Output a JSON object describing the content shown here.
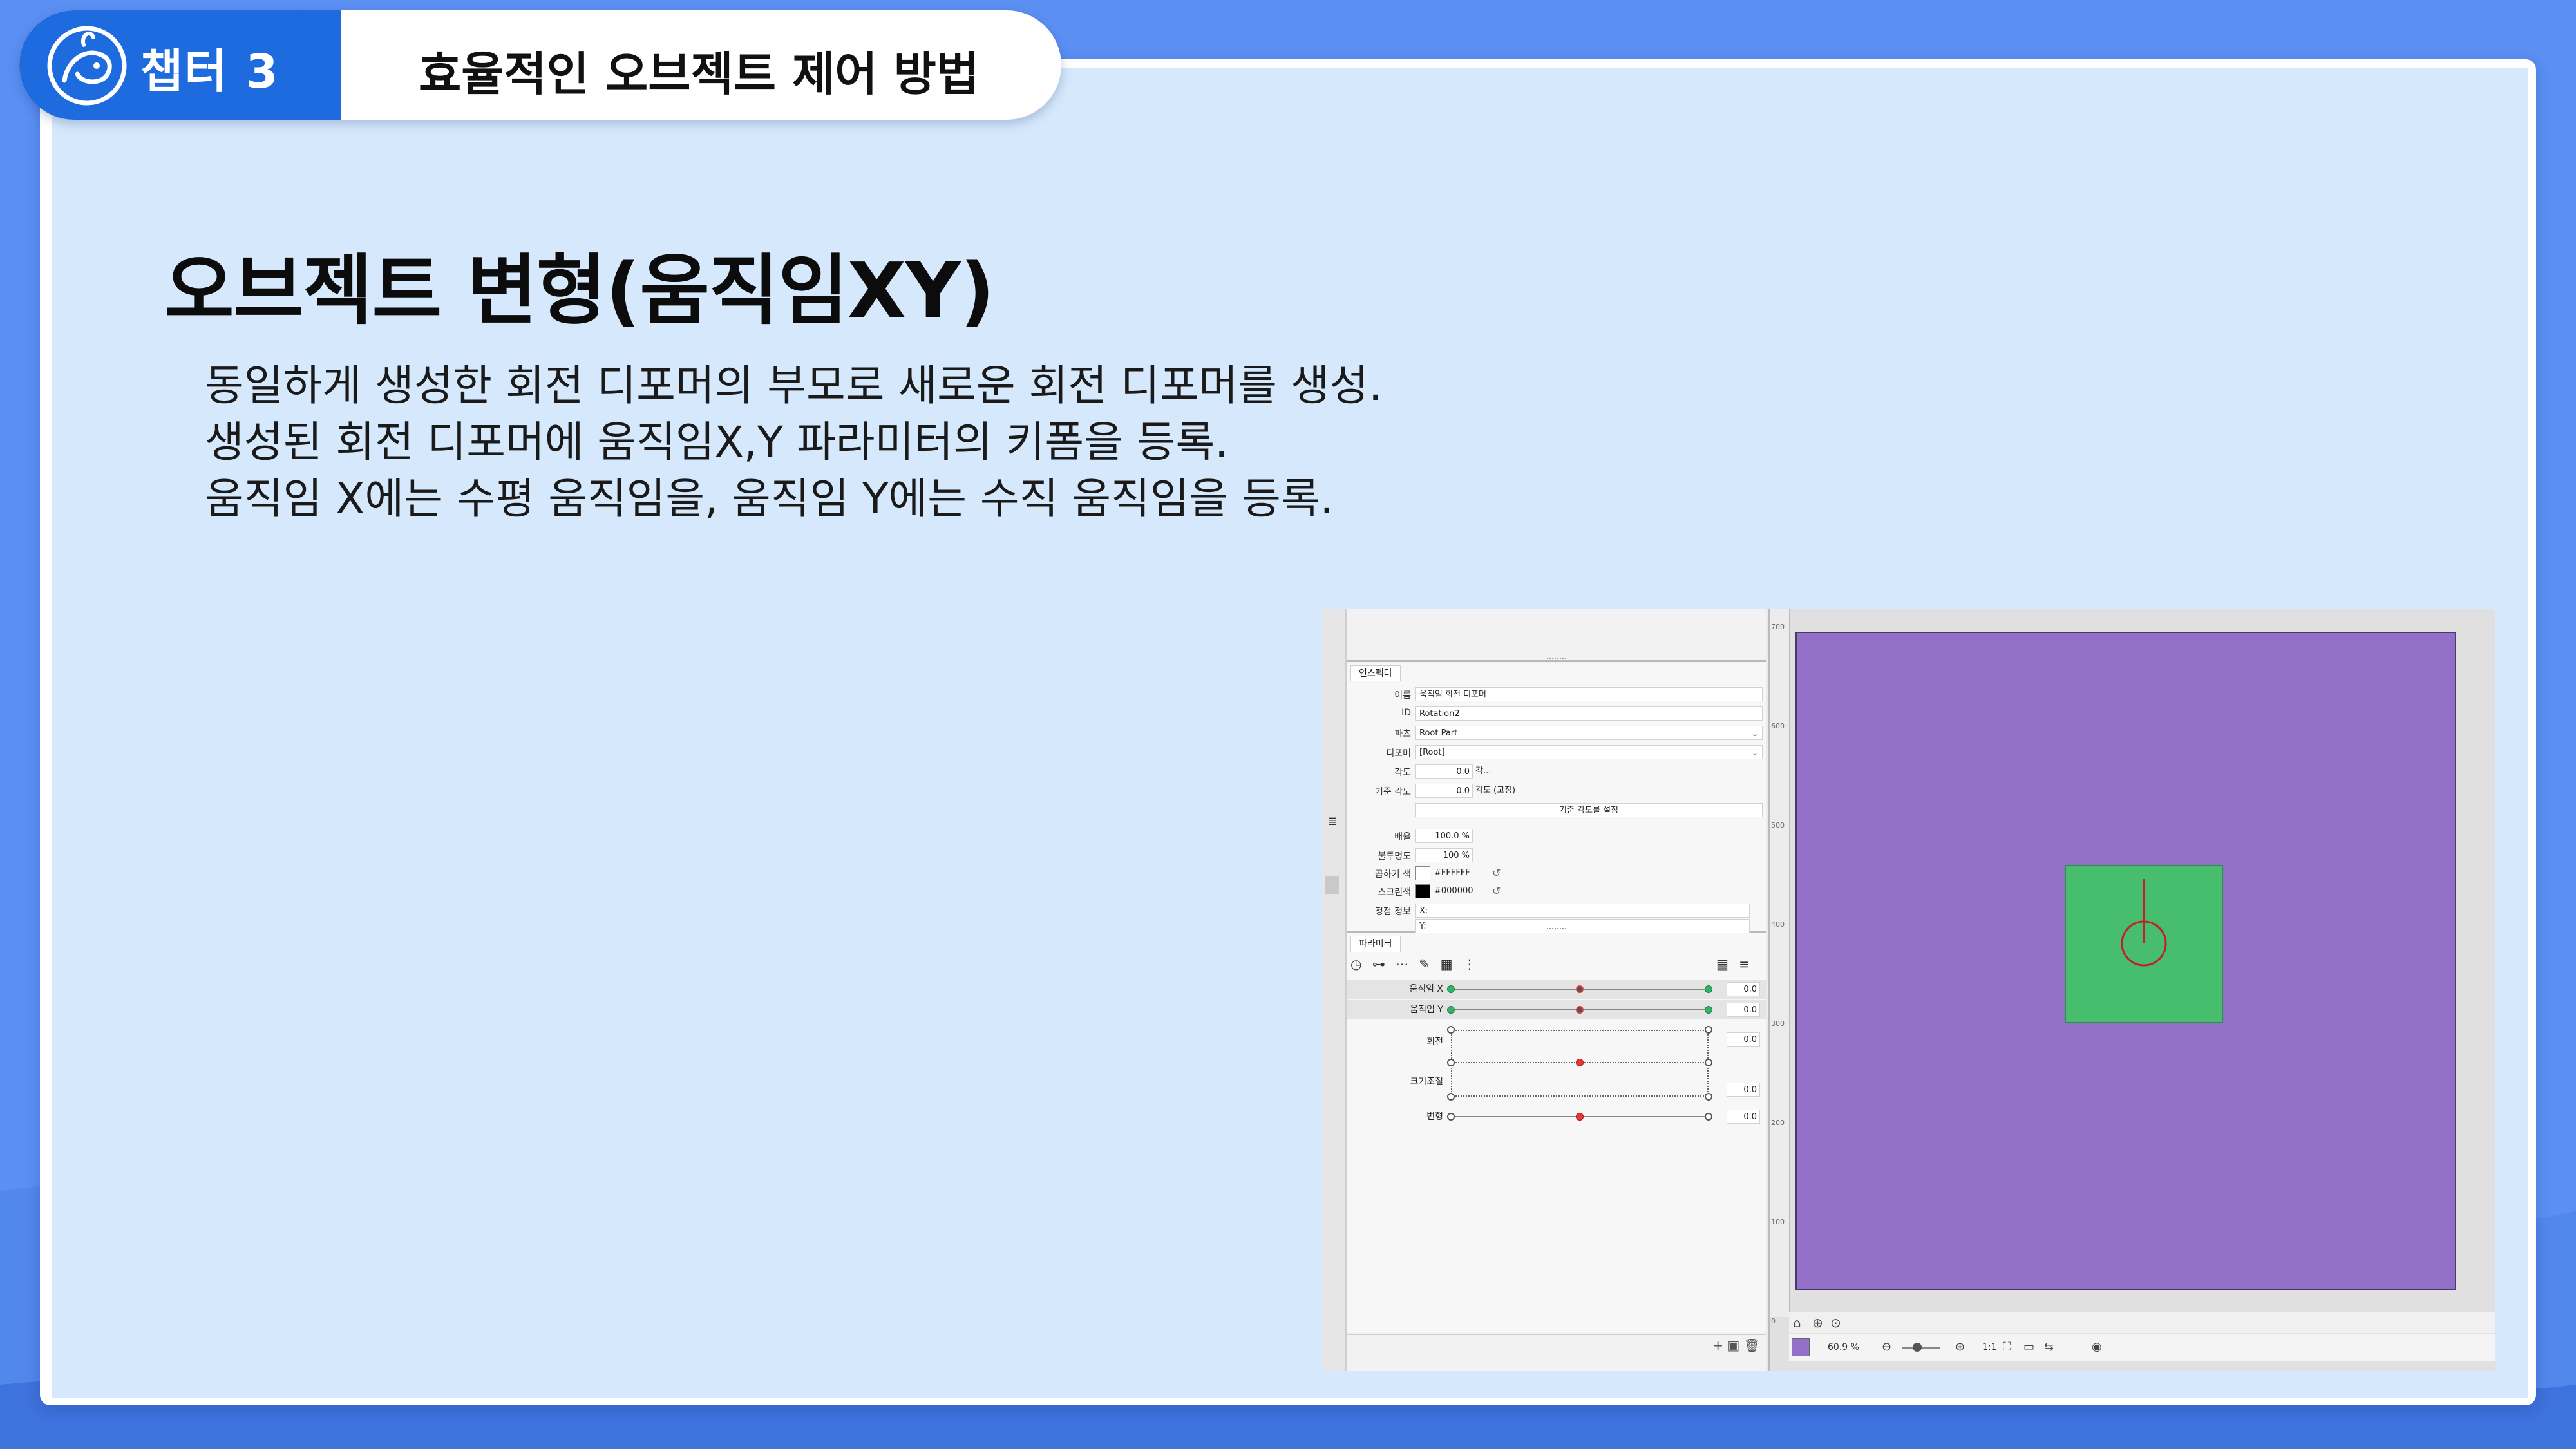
{
  "header": {
    "chapter_label": "챕터 3",
    "title": "효율적인 오브젝트 제어 방법"
  },
  "slide": {
    "title": "오브젝트 변형(움직임XY)",
    "lines": [
      "동일하게 생성한 회전 디포머의 부모로 새로운 회전 디포머를 생성.",
      "생성된 회전 디포머에 움직임X,Y 파라미터의 키폼을 등록.",
      "움직임 X에는 수평 움직임을, 움직임 Y에는 수직 움직임을 등록."
    ]
  },
  "screenshot": {
    "inspector": {
      "tab": "인스펙터",
      "name_label": "이름",
      "name_value": "움직임 회전 디포머",
      "id_label": "ID",
      "id_value": "Rotation2",
      "part_label": "파츠",
      "part_value": "Root Part",
      "deformer_label": "디포머",
      "deformer_value": "[Root]",
      "angle_label": "각도",
      "angle_value": "0.0",
      "angle_unit": "각...",
      "base_angle_label": "기준 각도",
      "base_angle_value": "0.0",
      "base_angle_unit": "각도 (고정)",
      "set_base_button": "기준 각도를 설정",
      "scale_label": "배율",
      "scale_value": "100.0 %",
      "opacity_label": "불투명도",
      "opacity_value": "100 %",
      "multiply_label": "곱하기 색",
      "multiply_value": "#FFFFFF",
      "screen_label": "스크린색",
      "screen_value": "#000000",
      "vertex_label": "정점 정보",
      "vertex_x": "X:",
      "vertex_y": "Y:"
    },
    "parameters": {
      "tab": "파라미터",
      "rows": [
        {
          "label": "움직임 X",
          "value": "0.0"
        },
        {
          "label": "움직임 Y",
          "value": "0.0"
        },
        {
          "label": "회전",
          "value": "0.0"
        },
        {
          "label": "크기조절",
          "value": "0.0"
        },
        {
          "label": "변형",
          "value": "0.0"
        }
      ]
    },
    "viewer": {
      "zoom": "60.9 %",
      "ruler_ticks": [
        "700",
        "600",
        "500",
        "400",
        "300",
        "200",
        "100",
        "0"
      ],
      "ratio": "1:1",
      "canvas_color": "#9370c8",
      "object_color": "#47be6e"
    }
  }
}
